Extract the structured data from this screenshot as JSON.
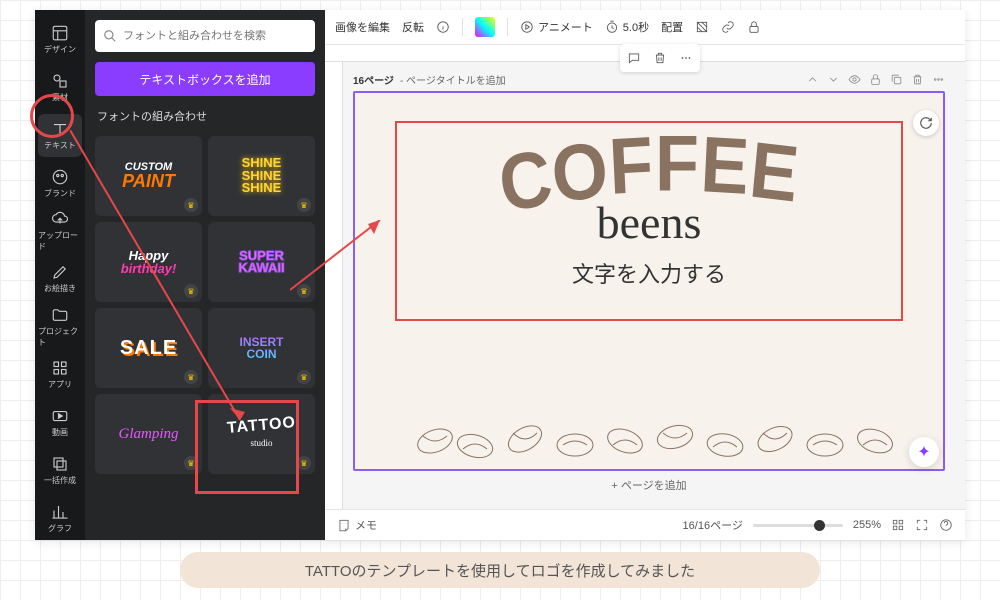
{
  "rail": {
    "items": [
      {
        "icon": "layout",
        "label": "デザイン"
      },
      {
        "icon": "shapes",
        "label": "素材"
      },
      {
        "icon": "text",
        "label": "テキスト"
      },
      {
        "icon": "brand",
        "label": "ブランド"
      },
      {
        "icon": "cloud",
        "label": "アップロード"
      },
      {
        "icon": "draw",
        "label": "お絵描き"
      },
      {
        "icon": "folder",
        "label": "プロジェクト"
      },
      {
        "icon": "apps",
        "label": "アプリ"
      },
      {
        "icon": "video",
        "label": "動画"
      },
      {
        "icon": "bulk",
        "label": "一括作成"
      },
      {
        "icon": "chart",
        "label": "グラフ"
      }
    ],
    "active": 2
  },
  "panel": {
    "search_placeholder": "フォントと組み合わせを検索",
    "add_textbox": "テキストボックスを追加",
    "section": "フォントの組み合わせ",
    "tiles": [
      {
        "line1": "CUSTOM",
        "line2": "PAINT",
        "key": "paint"
      },
      {
        "text": "SHINE\nSHINE\nSHINE",
        "key": "shine"
      },
      {
        "line1": "Happy",
        "line2": "birthday!",
        "key": "bday"
      },
      {
        "text": "SUPER\nKAWAII",
        "key": "kawaii"
      },
      {
        "text": "SALE",
        "key": "sale"
      },
      {
        "text": "INSERT\nCOIN",
        "key": "coin"
      },
      {
        "text": "Glamping",
        "key": "glamp"
      },
      {
        "line1": "TATTOO",
        "line2": "studio",
        "key": "tattoo"
      }
    ]
  },
  "toolbar": {
    "edit_image": "画像を編集",
    "flip": "反転",
    "animate": "アニメート",
    "timing": "5.0秒",
    "position": "配置"
  },
  "page": {
    "number": "16ページ",
    "title_hint": "- ページタイトルを追加",
    "add_page": "+ ページを追加"
  },
  "canvas": {
    "title": "COFFEE",
    "subtitle": "beens",
    "hint": "文字を入力する"
  },
  "footer": {
    "notes": "メモ",
    "page_counter": "16/16ページ",
    "zoom": "255%"
  },
  "caption": "TATTOのテンプレートを使用してロゴを作成してみました"
}
